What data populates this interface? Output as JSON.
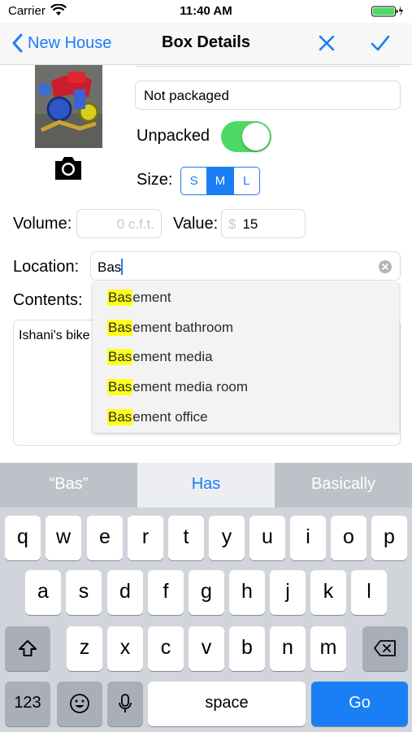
{
  "status_bar": {
    "carrier": "Carrier",
    "time": "11:40 AM"
  },
  "nav": {
    "back_label": "New House",
    "title": "Box Details"
  },
  "form": {
    "status_value": "Not packaged",
    "unpacked_label": "Unpacked",
    "unpacked_on": true,
    "size_label": "Size:",
    "size_options": [
      "S",
      "M",
      "L"
    ],
    "size_selected": "M",
    "volume_label": "Volume:",
    "volume_placeholder": "0  c.f.t.",
    "value_label": "Value:",
    "value_currency": "$",
    "value_amount": "15",
    "location_label": "Location:",
    "location_value": "Bas",
    "contents_label": "Contents:",
    "contents_value": "Ishani's bike"
  },
  "autocomplete": {
    "items": [
      {
        "match": "Bas",
        "rest": "ement"
      },
      {
        "match": "Bas",
        "rest": "ement bathroom"
      },
      {
        "match": "Bas",
        "rest": "ement media"
      },
      {
        "match": "Bas",
        "rest": "ement media room"
      },
      {
        "match": "Bas",
        "rest": "ement office"
      }
    ]
  },
  "keyboard": {
    "predictions": [
      "“Bas”",
      "Has",
      "Basically"
    ],
    "row1": [
      "q",
      "w",
      "e",
      "r",
      "t",
      "y",
      "u",
      "i",
      "o",
      "p"
    ],
    "row2": [
      "a",
      "s",
      "d",
      "f",
      "g",
      "h",
      "j",
      "k",
      "l"
    ],
    "row3": [
      "z",
      "x",
      "c",
      "v",
      "b",
      "n",
      "m"
    ],
    "numbers_label": "123",
    "space_label": "space",
    "go_label": "Go"
  },
  "colors": {
    "accent": "#1a7ef5",
    "toggle_on": "#4cd964",
    "highlight": "#ffff1c"
  }
}
